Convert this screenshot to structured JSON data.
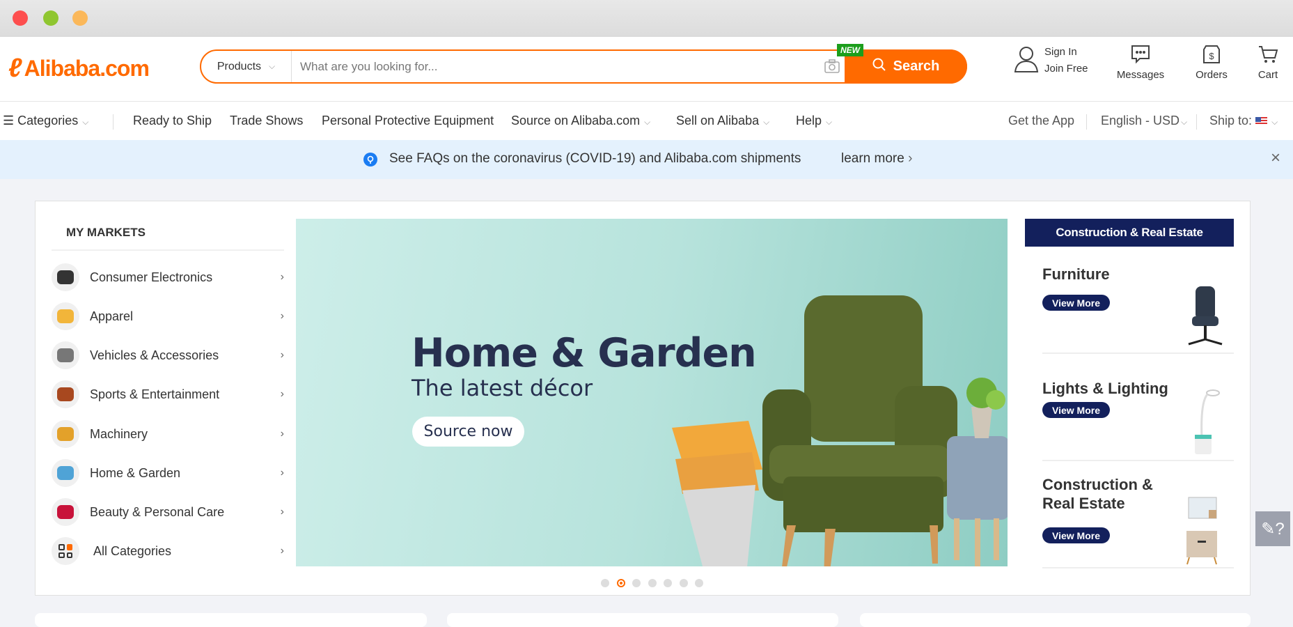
{
  "window": {
    "controls": [
      "close",
      "minimize",
      "maximize"
    ]
  },
  "header": {
    "logo": "Alibaba.com",
    "search": {
      "category": "Products",
      "placeholder": "What are you looking for...",
      "button": "Search",
      "badge": "NEW"
    },
    "account": {
      "sign_in": "Sign In",
      "join": "Join Free"
    },
    "messages": "Messages",
    "orders": "Orders",
    "cart": "Cart"
  },
  "nav": {
    "categories": "Categories",
    "items": [
      "Ready to Ship",
      "Trade Shows",
      "Personal Protective Equipment",
      "Source on Alibaba.com",
      "Sell on Alibaba",
      "Help"
    ],
    "get_app": "Get the App",
    "language": "English - USD",
    "ship_to": "Ship to:"
  },
  "notice": {
    "text": "See FAQs on the coronavirus (COVID-19) and Alibaba.com shipments",
    "link": "learn more"
  },
  "markets": {
    "title": "MY MARKETS",
    "items": [
      "Consumer Electronics",
      "Apparel",
      "Vehicles & Accessories",
      "Sports & Entertainment",
      "Machinery",
      "Home & Garden",
      "Beauty & Personal Care",
      "All Categories"
    ]
  },
  "hero": {
    "title": "Home & Garden",
    "subtitle": "The latest décor",
    "button": "Source now",
    "slides": 7,
    "active_slide": 2
  },
  "promo": {
    "header": "Construction & Real Estate",
    "items": [
      {
        "title": "Furniture",
        "button": "View More"
      },
      {
        "title": "Lights & Lighting",
        "button": "View More"
      },
      {
        "title": "Construction & Real Estate",
        "button": "View More"
      }
    ]
  },
  "colors": {
    "brand": "#ff6a00",
    "navy": "#13205c",
    "notice_bg": "#e4f1fd"
  }
}
